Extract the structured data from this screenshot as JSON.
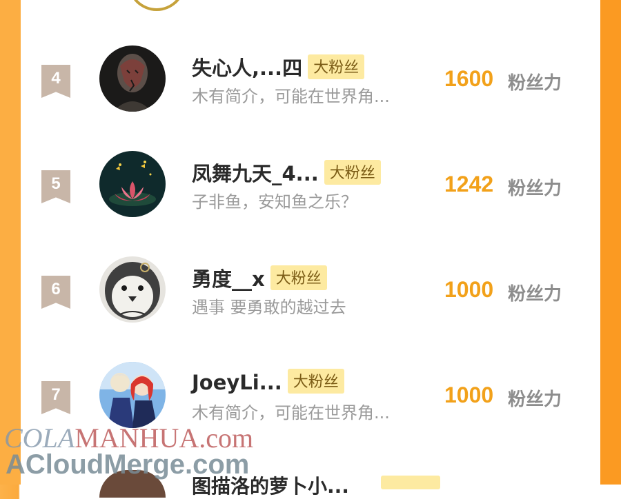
{
  "unit_label": "粉丝力",
  "badge_label": "大粉丝",
  "colors": {
    "accent_score": "#f2a11a",
    "badge_bg": "#fdeaa1",
    "rank_bg": "#c8b6a8",
    "side_bg": "#fb9a22"
  },
  "ranking": [
    {
      "rank": "4",
      "name": "失心人,...四",
      "bio": "木有简介，可能在世界角...",
      "score": "1600"
    },
    {
      "rank": "5",
      "name": "凤舞九天_4...",
      "bio": "子非鱼，安知鱼之乐？",
      "score": "1242"
    },
    {
      "rank": "6",
      "name": "勇度__x",
      "bio": "遇事 要勇敢的越过去",
      "score": "1000"
    },
    {
      "rank": "7",
      "name": "JoeyLi...",
      "bio": "木有简介，可能在世界角...",
      "score": "1000"
    }
  ],
  "next_row": {
    "name": "图描洛的萝卜小..."
  },
  "watermark": {
    "line1_a": "COLA",
    "line1_b": "MANHUA.com",
    "line2": "ACloudMerge.com"
  }
}
